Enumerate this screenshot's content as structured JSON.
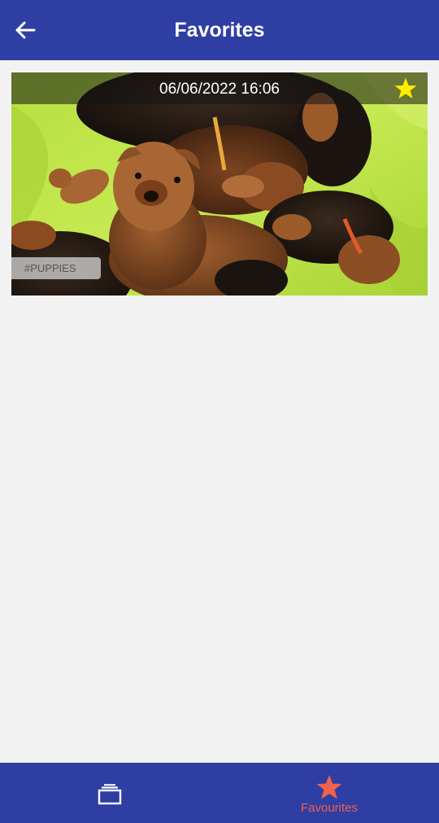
{
  "header": {
    "title": "Favorites",
    "back_icon": "arrow-back-icon"
  },
  "photos": [
    {
      "date": "06/06/2022 16:06",
      "tag": "#PUPPIES",
      "favorite": true,
      "favorite_icon": "star-icon",
      "favorite_color": "#ffee00",
      "image_description": "puppies-photo"
    }
  ],
  "bottom_nav": {
    "items": [
      {
        "icon": "photo-stack-icon",
        "label": "",
        "active": false
      },
      {
        "icon": "star-icon",
        "label": "Favourites",
        "active": true
      }
    ],
    "active_color": "#f2604e",
    "background": "#2e3ea3"
  },
  "colors": {
    "primary": "#2e3ea3",
    "background": "#f2f2f2",
    "accent": "#f2604e"
  }
}
